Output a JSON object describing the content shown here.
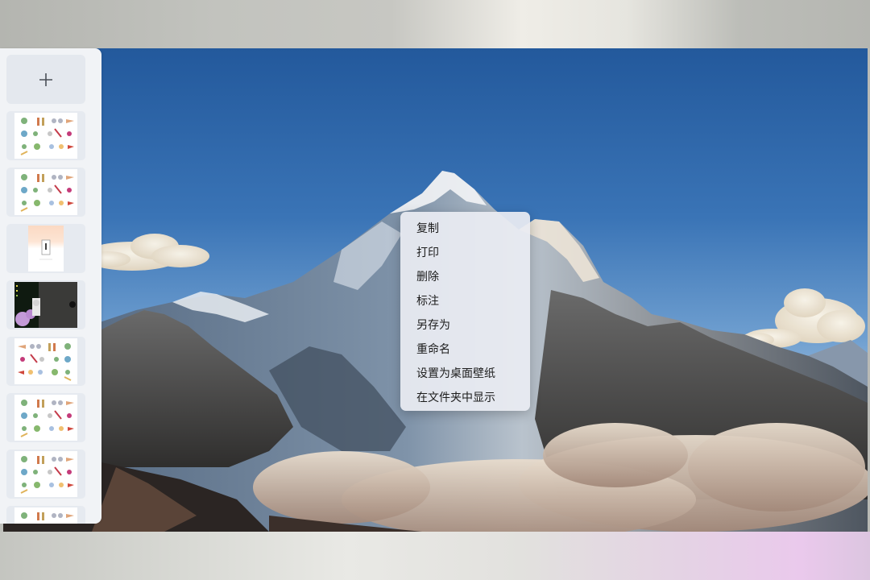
{
  "window": {
    "viewer": "image viewer",
    "background_blur_colors": [
      "#bfc0bb",
      "#eeece6",
      "#eac9ec"
    ]
  },
  "photo": {
    "description_icon": "mountain-landscape-photo"
  },
  "thumbnails": {
    "add_icon": "plus-icon",
    "items": [
      {
        "kind": "sticker-sheet"
      },
      {
        "kind": "sticker-sheet"
      },
      {
        "kind": "document-page"
      },
      {
        "kind": "dark-screenshot"
      },
      {
        "kind": "sticker-sheet-mirrored"
      },
      {
        "kind": "sticker-sheet"
      },
      {
        "kind": "sticker-sheet"
      },
      {
        "kind": "sticker-sheet"
      }
    ]
  },
  "context_menu": {
    "items": [
      {
        "label": "复制"
      },
      {
        "label": "打印"
      },
      {
        "label": "删除"
      },
      {
        "label": "标注"
      },
      {
        "label": "另存为"
      },
      {
        "label": "重命名"
      },
      {
        "label": "设置为桌面壁纸"
      },
      {
        "label": "在文件夹中显示"
      }
    ]
  },
  "colors": {
    "sky_top": "#2b62a4",
    "sky_bottom": "#8db8dd",
    "panel_bg": "#f1f3f6",
    "menu_bg": "#e9ecf2"
  }
}
